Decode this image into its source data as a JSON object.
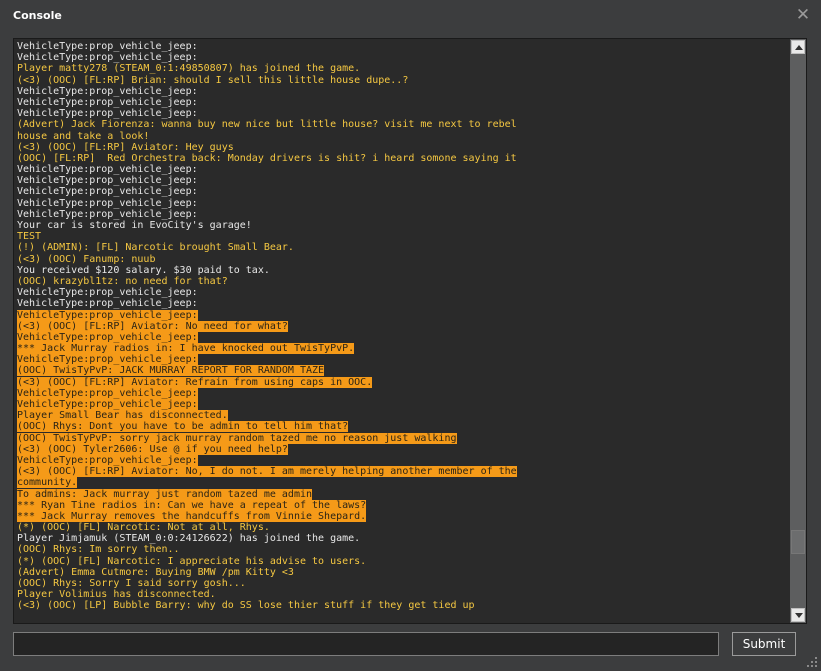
{
  "window": {
    "title": "Console"
  },
  "input": {
    "value": "",
    "placeholder": ""
  },
  "submit": {
    "label": "Submit"
  },
  "colors": {
    "text": "#f5c842",
    "highlight": "#f59a18",
    "background": "#3c3d3e"
  },
  "log": [
    {
      "text": "VehicleType:prop_vehicle_jeep:",
      "white": true,
      "hl": false
    },
    {
      "text": "VehicleType:prop_vehicle_jeep:",
      "white": true,
      "hl": false
    },
    {
      "text": "Player matty278 (STEAM_0:1:49850807) has joined the game.",
      "white": false,
      "hl": false
    },
    {
      "text": "(<3) (OOC) [FL:RP] Brian: should I sell this little house dupe..?",
      "white": false,
      "hl": false
    },
    {
      "text": "VehicleType:prop_vehicle_jeep:",
      "white": true,
      "hl": false
    },
    {
      "text": "VehicleType:prop_vehicle_jeep:",
      "white": true,
      "hl": false
    },
    {
      "text": "VehicleType:prop_vehicle_jeep:",
      "white": true,
      "hl": false
    },
    {
      "text": "(Advert) Jack Fiorenza: wanna buy new nice but little house? visit me next to rebel",
      "white": false,
      "hl": false
    },
    {
      "text": "house and take a look!",
      "white": false,
      "hl": false
    },
    {
      "text": "(<3) (OOC) [FL:RP] Aviator: Hey guys",
      "white": false,
      "hl": false
    },
    {
      "text": "(OOC) [FL:RP]  Red Orchestra back: Monday drivers is shit? i heard somone saying it",
      "white": false,
      "hl": false
    },
    {
      "text": "VehicleType:prop_vehicle_jeep:",
      "white": true,
      "hl": false
    },
    {
      "text": "VehicleType:prop_vehicle_jeep:",
      "white": true,
      "hl": false
    },
    {
      "text": "VehicleType:prop_vehicle_jeep:",
      "white": true,
      "hl": false
    },
    {
      "text": "VehicleType:prop_vehicle_jeep:",
      "white": true,
      "hl": false
    },
    {
      "text": "VehicleType:prop_vehicle_jeep:",
      "white": true,
      "hl": false
    },
    {
      "text": "Your car is stored in EvoCity's garage!",
      "white": true,
      "hl": false
    },
    {
      "text": "TEST",
      "white": false,
      "hl": false
    },
    {
      "text": "(!) (ADMIN): [FL] Narcotic brought Small Bear.",
      "white": false,
      "hl": false
    },
    {
      "text": "(<3) (OOC) Fanump: nuub",
      "white": false,
      "hl": false
    },
    {
      "text": "You received $120 salary. $30 paid to tax.",
      "white": true,
      "hl": false
    },
    {
      "text": "(OOC) krazybl1tz: no need for that?",
      "white": false,
      "hl": false
    },
    {
      "text": "VehicleType:prop_vehicle_jeep:",
      "white": true,
      "hl": false
    },
    {
      "text": "VehicleType:prop_vehicle_jeep:",
      "white": true,
      "hl": false
    },
    {
      "text": "VehicleType:prop_vehicle_jeep:",
      "white": true,
      "hl": true
    },
    {
      "text": "(<3) (OOC) [FL:RP] Aviator: No need for what?",
      "white": false,
      "hl": true
    },
    {
      "text": "VehicleType:prop_vehicle_jeep:",
      "white": true,
      "hl": true
    },
    {
      "text": "*** Jack Murray radios in: I have knocked out TwisTyPvP.",
      "white": false,
      "hl": true
    },
    {
      "text": "VehicleType:prop_vehicle_jeep:",
      "white": true,
      "hl": true
    },
    {
      "text": "(OOC) TwisTyPvP: JACK MURRAY REPORT FOR RANDOM TAZE",
      "white": false,
      "hl": true
    },
    {
      "text": "(<3) (OOC) [FL:RP] Aviator: Refrain from using caps in OOC.",
      "white": false,
      "hl": true
    },
    {
      "text": "VehicleType:prop_vehicle_jeep:",
      "white": true,
      "hl": true
    },
    {
      "text": "VehicleType:prop_vehicle_jeep:",
      "white": true,
      "hl": true
    },
    {
      "text": "Player Small Bear has disconnected.",
      "white": false,
      "hl": true
    },
    {
      "text": "(OOC) Rhys: Dont you have to be admin to tell him that?",
      "white": false,
      "hl": true
    },
    {
      "text": "(OOC) TwisTyPvP: sorry jack murray random tazed me no reason just walking",
      "white": false,
      "hl": true
    },
    {
      "text": "(<3) (OOC) Tyler2606: Use @ if you need help?",
      "white": false,
      "hl": true
    },
    {
      "text": "VehicleType:prop_vehicle_jeep:",
      "white": true,
      "hl": true
    },
    {
      "text": "(<3) (OOC) [FL:RP] Aviator: No, I do not. I am merely helping another member of the",
      "white": false,
      "hl": true
    },
    {
      "text": "community.",
      "white": false,
      "hl": true
    },
    {
      "text": "To admins: Jack murray just random tazed me admin",
      "white": false,
      "hl": true
    },
    {
      "text": "*** Ryan Tine radios in: Can we have a repeat of the laws?",
      "white": false,
      "hl": true
    },
    {
      "text": "*** Jack Murray removes the handcuffs from Vinnie Shepard.",
      "white": false,
      "hl": true
    },
    {
      "text": "(*) (OOC) [FL] Narcotic: Not at all, Rhys.",
      "white": false,
      "hl": false
    },
    {
      "text": "Player Jimjamuk (STEAM_0:0:24126622) has joined the game.",
      "white": true,
      "hl": false
    },
    {
      "text": "(OOC) Rhys: Im sorry then..",
      "white": false,
      "hl": false
    },
    {
      "text": "(*) (OOC) [FL] Narcotic: I appreciate his advise to users.",
      "white": false,
      "hl": false
    },
    {
      "text": "(Advert) Emma Cutmore: Buying BMW /pm Kitty <3",
      "white": false,
      "hl": false
    },
    {
      "text": "(OOC) Rhys: Sorry I said sorry gosh...",
      "white": false,
      "hl": false
    },
    {
      "text": "Player Volimius has disconnected.",
      "white": false,
      "hl": false
    },
    {
      "text": "(<3) (OOC) [LP] Bubble Barry: why do SS lose thier stuff if they get tied up",
      "white": false,
      "hl": false
    }
  ]
}
